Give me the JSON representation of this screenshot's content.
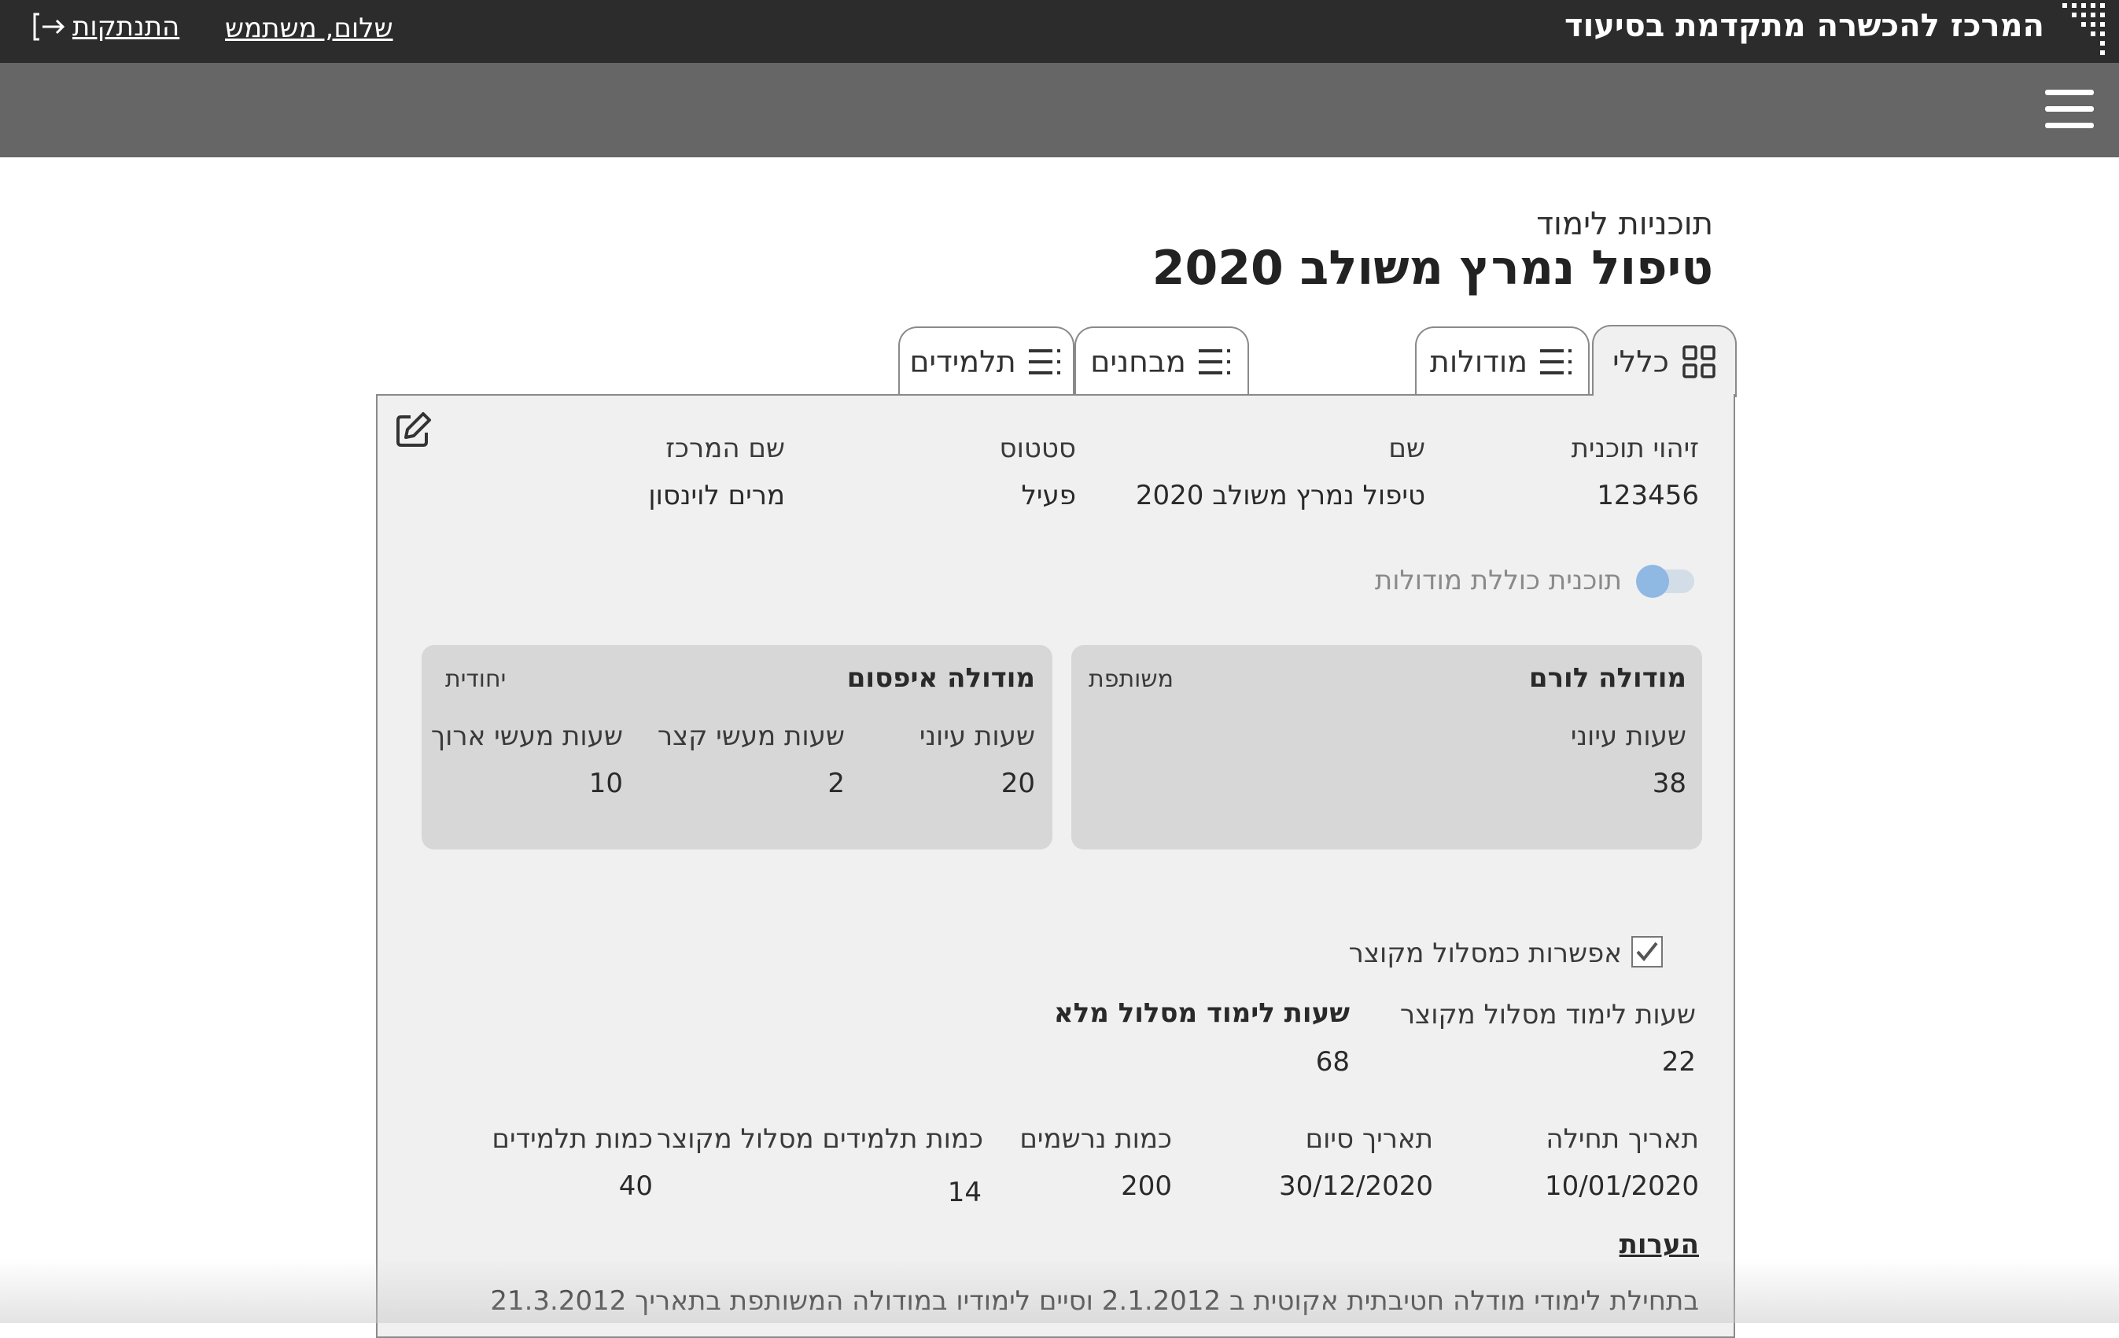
{
  "header": {
    "brand_title": "המרכז להכשרה מתקדמת בסיעוד",
    "greeting": "שלום, משתמש",
    "logout_label": "התנתקות"
  },
  "page": {
    "subtitle": "תוכניות לימוד",
    "title": "טיפול נמרץ משולב 2020"
  },
  "tabs": [
    {
      "label": "כללי",
      "icon": "grid-icon",
      "active": true
    },
    {
      "label": "מודולות",
      "icon": "list-icon",
      "active": false
    },
    {
      "label": "מבחנים",
      "icon": "list-icon",
      "active": false
    },
    {
      "label": "תלמידים",
      "icon": "list-icon",
      "active": false
    }
  ],
  "general": {
    "fields": [
      {
        "label": "זיהוי תוכנית",
        "value": "123456"
      },
      {
        "label": "שם",
        "value": "טיפול נמרץ משולב 2020"
      },
      {
        "label": "סטטוס",
        "value": "פעיל"
      },
      {
        "label": "שם המרכז",
        "value": "מרים לוינסון"
      }
    ],
    "modules_toggle_label": "תוכנית כוללת מודולות",
    "modules_toggle_on": false,
    "modules": [
      {
        "name": "מודולה לורם",
        "type": "משותפת",
        "stats": [
          {
            "label": "שעות עיוני",
            "value": "38"
          }
        ]
      },
      {
        "name": "מודולה איפסום",
        "type": "יחודית",
        "stats": [
          {
            "label": "שעות עיוני",
            "value": "20"
          },
          {
            "label": "שעות מעשי קצר",
            "value": "2"
          },
          {
            "label": "שעות מעשי ארוך",
            "value": "10"
          }
        ]
      }
    ],
    "short_track_checkbox_label": "אפשרות כמסלול מקוצר",
    "short_track_checked": true,
    "hours": [
      {
        "label": "שעות לימוד מסלול מקוצר",
        "value": "22"
      },
      {
        "label": "שעות לימוד מסלול מלא",
        "value": "68"
      }
    ],
    "dates": [
      {
        "label": "תאריך תחילה",
        "value": "10/01/2020"
      },
      {
        "label": "תאריך סיום",
        "value": "30/12/2020"
      },
      {
        "label": "כמות נרשמים",
        "value": "200"
      },
      {
        "label": "כמות תלמידים מסלול מקוצר",
        "value": "14"
      },
      {
        "label": "כמות תלמידים",
        "value": "40"
      }
    ],
    "notes_title": "הערות",
    "notes_text": "בתחילת לימודי מודלה חטיבתית אקוטית ב 2.1.2012 וסיים לימודיו במודולה המשותפת בתאריך 21.3.2012"
  },
  "colors": {
    "topbar": "#2c2c2c",
    "subbar": "#666666",
    "panel": "#f0f0f0",
    "card": "#d7d7d7",
    "toggle_knob": "#8fb8e2"
  }
}
